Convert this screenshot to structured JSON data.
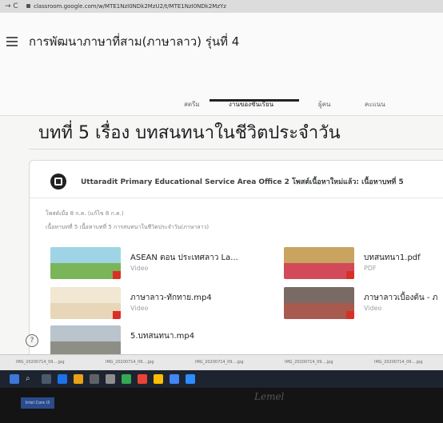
{
  "browser": {
    "nav_glyphs": "→ C",
    "url": "classroom.google.com/w/MTE1NzI0NDk2MzU2/t/MTE1NzI0NDk2MzYz"
  },
  "header": {
    "class_title": "การพัฒนาภาษาที่สาม(ภาษาลาว) รุ่นที่ 4",
    "tabs": [
      {
        "label": "สตรีม"
      },
      {
        "label": "งานของชั้นเรียน"
      },
      {
        "label": "ผู้คน"
      },
      {
        "label": "คะแนน"
      }
    ],
    "active_tab": "งานของชั้นเรียน"
  },
  "main": {
    "lesson_title": "บทที่ 5 เรื่อง บทสนทนาในชีวิตประจำวัน",
    "post": {
      "author": "Uttaradit Primary Educational Service Area Office 2 โพสต์เนื้อหาใหม่แล้ว: เนื้อหาบทที่ 5",
      "date": "โพสต์เมื่อ 8 ก.ค. (แก้ไข 8 ก.ค.)",
      "description": "เนื้อหาบทที่ 5 เนื้อหาบทที่ 5 การสนทนาในชีวิตประจำวัน(ภาษาลาว)",
      "attachments": [
        {
          "name": "ASEAN ตอน ประเทศลาว La...",
          "kind": "Video"
        },
        {
          "name": "บทสนทนา1.pdf",
          "kind": "PDF"
        },
        {
          "name": "ภาษาลาว-ทักทาย.mp4",
          "kind": "Video"
        },
        {
          "name": "ภาษาลาวเบื้องต้น - ภ",
          "kind": "Video"
        },
        {
          "name": "5.บทสนทนา.mp4",
          "kind": ""
        }
      ]
    },
    "help_glyph": "?"
  },
  "downloads": [
    {
      "label": "IMG_20200714_09....jpg"
    },
    {
      "label": "IMG_20200714_09....jpg"
    },
    {
      "label": "IMG_20200714_09....jpg"
    },
    {
      "label": "IMG_20200714_09....jpg"
    },
    {
      "label": "IMG_20200714_09....jpg"
    }
  ],
  "taskbar": {
    "search_glyph": "⌕",
    "sticker_text": "Intel Core i3"
  },
  "monitor": {
    "brand": "Lemel"
  },
  "colors": {
    "accent": "#202124",
    "pdf_red": "#d93025",
    "taskbar": "#1d2430"
  }
}
